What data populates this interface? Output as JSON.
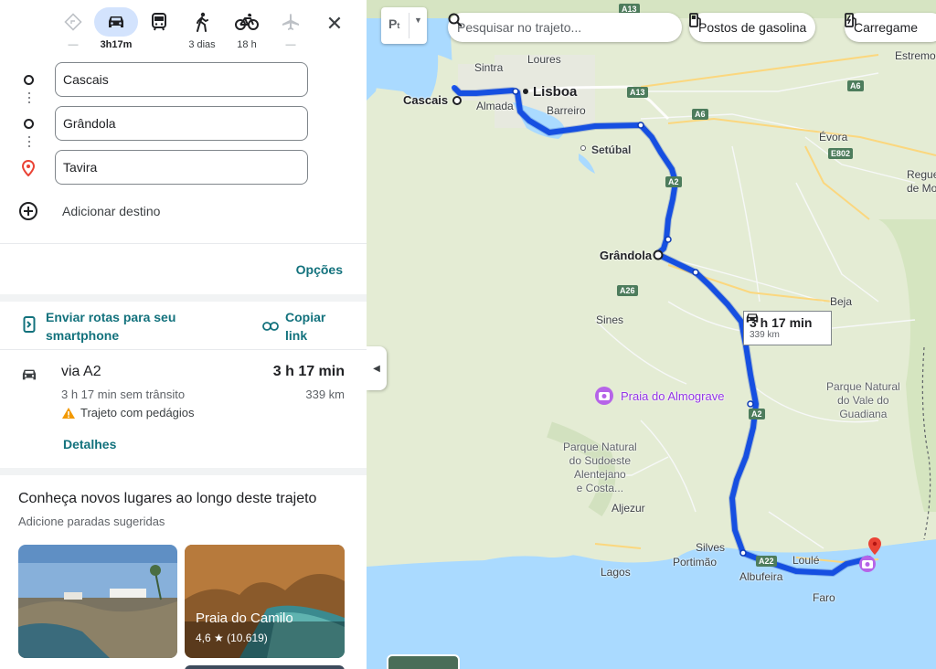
{
  "modes": [
    {
      "icon": "best-route-icon",
      "label": ""
    },
    {
      "icon": "car-icon",
      "label": "3h17m",
      "selected": true
    },
    {
      "icon": "transit-icon",
      "label": ""
    },
    {
      "icon": "walk-icon",
      "label": "3 dias"
    },
    {
      "icon": "bicycle-icon",
      "label": "18 h"
    },
    {
      "icon": "flight-icon",
      "label": ""
    }
  ],
  "waypoints": [
    "Cascais",
    "Grândola",
    "Tavira"
  ],
  "add_destination": "Adicionar destino",
  "options": "Opções",
  "send_to_phone": "Enviar rotas para seu smartphone",
  "copy_link": "Copiar link",
  "route": {
    "title": "via A2",
    "time": "3 h 17 min",
    "no_traffic": "3 h 17 min sem trânsito",
    "distance": "339 km",
    "warning": "Trajeto com pedágios",
    "details": "Detalhes"
  },
  "suggestions": {
    "title": "Conheça novos lugares ao longo deste trajeto",
    "subtitle": "Adicione paradas sugeridas",
    "cards": [
      {
        "name": "",
        "rating": ""
      },
      {
        "name": "Praia do Camilo",
        "rating": "4,6 ★ (10.619)"
      }
    ]
  },
  "map": {
    "search_placeholder": "Pesquisar no trajeto...",
    "chip_gas": "Postos de gasolina",
    "chip_charge": "Carregame",
    "callout_time": "3 h 17 min",
    "callout_dist": "339 km",
    "cities": {
      "cascais": "Cascais",
      "lisboa": "Lisboa",
      "grandola": "Grândola",
      "sintra": "Sintra",
      "loures": "Loures",
      "almada": "Almada",
      "barreiro": "Barreiro",
      "setubal": "Setúbal",
      "evora": "Évora",
      "estremoz": "Estremo",
      "reguengos1": "Regue",
      "reguengos2": "de Mo",
      "beja": "Beja",
      "sines": "Sines",
      "aljezur": "Aljezur",
      "silves": "Silves",
      "portimao": "Portimão",
      "lagos": "Lagos",
      "albufeira": "Albufeira",
      "loule": "Loulé",
      "faro": "Faro"
    },
    "pois": {
      "almograve": "Praia do Almograve"
    },
    "parks": {
      "guadiana": [
        "Parque Natural",
        "do Vale do",
        "Guadiana"
      ],
      "sudoeste": [
        "Parque Natural",
        "do Sudoeste",
        "Alentejano",
        "e Costa..."
      ]
    },
    "roads": [
      "A13",
      "A13",
      "A6",
      "A6",
      "E802",
      "A2",
      "A26",
      "A2",
      "A22"
    ]
  },
  "colors": {
    "route": "#1a56f0",
    "accent": "#13727d",
    "selected_mode": "#d3e3fd"
  }
}
